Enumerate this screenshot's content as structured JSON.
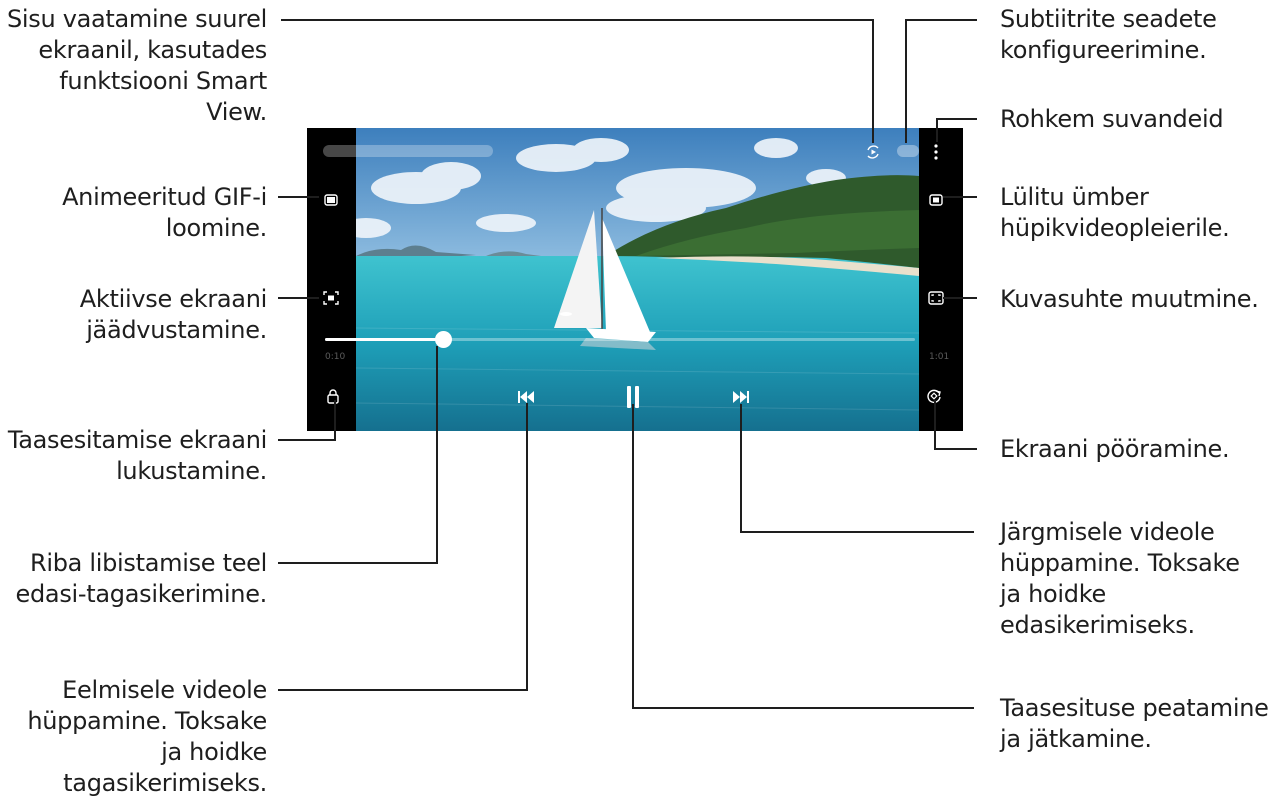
{
  "labels": {
    "smart_view": "Sisu vaatamine suurel\nekraanil, kasutades\nfunktsiooni Smart\nView.",
    "gif": "Animeeritud GIF-i\nloomine.",
    "capture": "Aktiivse ekraani\njäädvustamine.",
    "lock": "Taasesitamise ekraani\nlukustamine.",
    "seek": "Riba libistamise teel\nedasi-tagasikerimine.",
    "previous": "Eelmisele videole\nhüppamine. Toksake\nja hoidke\ntagasikerimiseks.",
    "subtitles": "Subtiitrite seadete\nkonfigureerimine.",
    "more": "Rohkem suvandeid",
    "popup": "Lülitu ümber\nhüpikvideopleierile.",
    "ratio": "Kuvasuhte muutmine.",
    "rotate": "Ekraani pööramine.",
    "next": "Järgmisele videole\nhüppamine. Toksake\nja hoidke\nedasikerimiseks.",
    "pause": "Taasesituse peatamine\nja jätkamine."
  },
  "player": {
    "progress": 0.2,
    "is_playing": true
  },
  "colors": {
    "text": "#1e1e1e",
    "accent_line": "#1e1e1e",
    "sea": "#2bb3c4",
    "sky": "#4d8fc4"
  },
  "icons": [
    "smart-view-icon",
    "subtitles-icon",
    "more-options-icon",
    "gif-icon",
    "capture-icon",
    "popup-player-icon",
    "aspect-ratio-icon",
    "lock-icon",
    "previous-icon",
    "pause-icon",
    "next-icon",
    "rotate-icon"
  ]
}
